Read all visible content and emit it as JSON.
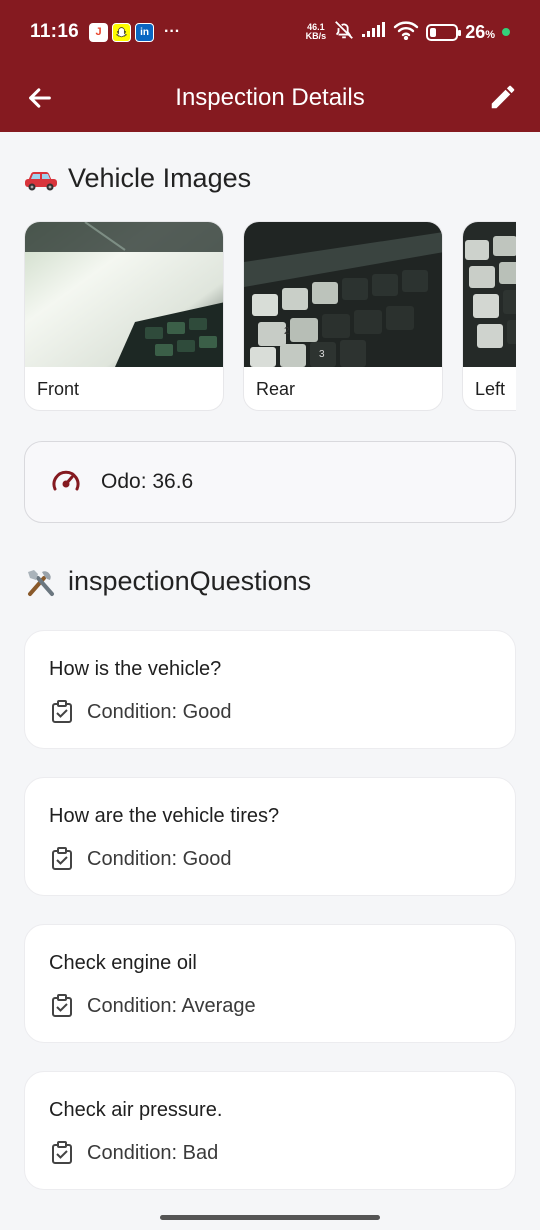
{
  "status_bar": {
    "time": "11:16",
    "app_icons": [
      "notification-app-icon",
      "snapchat-icon",
      "linkedin-icon"
    ],
    "more": "···",
    "net_speed_value": "46.1",
    "net_speed_unit": "KB/s",
    "battery_percent": "26",
    "battery_level": 0.26
  },
  "app_bar": {
    "title": "Inspection Details"
  },
  "vehicle_images": {
    "emoji": "🚗",
    "title": "Vehicle Images",
    "items": [
      {
        "label": "Front"
      },
      {
        "label": "Rear"
      },
      {
        "label": "Left"
      }
    ]
  },
  "odometer": {
    "text": "Odo: 36.6"
  },
  "inspection": {
    "emoji": "🛠️",
    "title": "inspectionQuestions",
    "questions": [
      {
        "question": "How is the vehicle?",
        "condition": "Condition: Good"
      },
      {
        "question": "How are the vehicle tires?",
        "condition": "Condition: Good"
      },
      {
        "question": "Check engine oil",
        "condition": "Condition: Average"
      },
      {
        "question": "Check air pressure.",
        "condition": "Condition: Bad"
      }
    ]
  },
  "colors": {
    "brand": "#851a20",
    "background": "#f5f6f8",
    "card": "#ffffff"
  }
}
